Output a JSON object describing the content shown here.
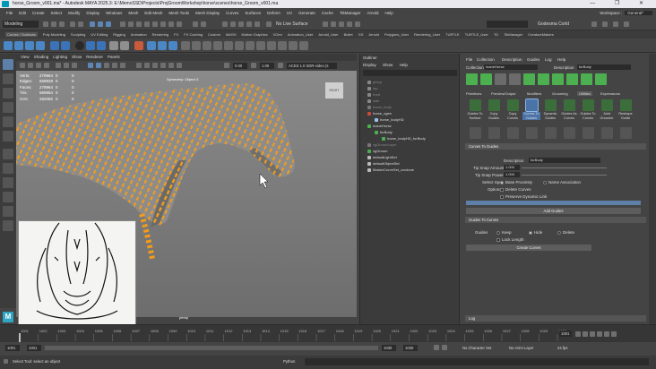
{
  "window": {
    "title": "horse_Groom_v001.ma* - Autodesk MAYA 2025.3: E:\\MemoSSD\\Projects\\ProjGroomWorkshop\\horse\\scenes\\horse_Groom_v001.ma",
    "controls": "— ❐ ✕"
  },
  "menubar": {
    "items": [
      "File",
      "Edit",
      "Create",
      "Select",
      "Modify",
      "Display",
      "Windows",
      "Mesh",
      "Edit Mesh",
      "Mesh Tools",
      "Mesh Display",
      "Curves",
      "Surfaces",
      "Deform",
      "UV",
      "Generate",
      "Cache",
      "TikManager",
      "Arnold",
      "Help"
    ],
    "workspace_label": "Workspace :",
    "workspace_value": "General*"
  },
  "statusline": {
    "mode": "Modeling",
    "live_surface": "No Live Surface",
    "user": "Godesma Corld"
  },
  "shelf": {
    "tabs": [
      "Curves / Surfaces",
      "Poly Modeling",
      "Sculpting",
      "UV Editing",
      "Rigging",
      "Animation",
      "Rendering",
      "FX",
      "FX Caching",
      "Custom",
      "MASH",
      "Motion Graphics",
      "XGen",
      "Animation_User",
      "Arnold_User",
      "Bullet",
      "GS",
      "Arnold",
      "Polygons_User",
      "Rendering_User",
      "TURTLE",
      "TURTLE_User",
      "TD",
      "TikManager",
      "CreatureMakers"
    ],
    "active_tab": 0
  },
  "viewport": {
    "menu": [
      "View",
      "Shading",
      "Lighting",
      "Show",
      "Renderer",
      "Panels"
    ],
    "hud": [
      {
        "label": "Verts:",
        "a": "279964",
        "b": "0",
        "c": "0"
      },
      {
        "label": "Edges:",
        "a": "559928",
        "b": "0",
        "c": "0"
      },
      {
        "label": "Faces:",
        "a": "279964",
        "b": "0",
        "c": "0"
      },
      {
        "label": "Tris:",
        "a": "559964",
        "b": "0",
        "c": "0"
      },
      {
        "label": "UVs:",
        "a": "282082",
        "b": "0",
        "c": "0"
      }
    ],
    "symmetry": "Symmetry: Object X",
    "camera": "persp",
    "viewcube": "RIGHT",
    "exposure": "0.00",
    "gamma": "1.00",
    "colorspace": "ACES 1.0 SDR-video (s"
  },
  "outliner": {
    "title": "Outliner",
    "menu": [
      "Display",
      "Show",
      "Help"
    ],
    "items": [
      {
        "label": "persp",
        "dim": true,
        "indent": 0
      },
      {
        "label": "top",
        "dim": true,
        "indent": 0
      },
      {
        "label": "front",
        "dim": true,
        "indent": 0
      },
      {
        "label": "side",
        "dim": true,
        "indent": 0
      },
      {
        "label": "horse_body",
        "dim": true,
        "indent": 0
      },
      {
        "label": "horse_xgen",
        "dim": false,
        "indent": 0
      },
      {
        "label": "horse_bodyHD",
        "dim": false,
        "indent": 1
      },
      {
        "label": "maneHorse",
        "dim": false,
        "indent": 0
      },
      {
        "label": "furBody",
        "dim": false,
        "indent": 1
      },
      {
        "label": "horse_bodyHD_furBody",
        "dim": false,
        "indent": 2
      },
      {
        "label": "xgGroomLayer",
        "dim": true,
        "indent": 0
      },
      {
        "label": "xgGroom",
        "dim": false,
        "indent": 0
      },
      {
        "label": "defaultLightSet",
        "dim": false,
        "indent": 0
      },
      {
        "label": "defaultObjectSet",
        "dim": false,
        "indent": 0
      },
      {
        "label": "MasterCurveSet_xxxdone",
        "dim": false,
        "indent": 0
      }
    ]
  },
  "xgen": {
    "menu": [
      "File",
      "Collection",
      "Description",
      "Guides",
      "Log",
      "Help"
    ],
    "collection_label": "Collection",
    "collection_value": "maneHorse",
    "description_label": "Description",
    "description_value": "furBody",
    "tabs": [
      "Primitives",
      "Preview/Output",
      "Modifiers",
      "Grooming",
      "Utilities",
      "Expressions"
    ],
    "tools": [
      "Guides To Surface",
      "Copy Guides",
      "Copy Curves",
      "Curves To Guides",
      "Dynamic Guides",
      "Guides As Curves",
      "Guides To Curves",
      "Joint Groomer",
      "Reshape Guide"
    ],
    "curves_to_guides_section": "Curves To Guides",
    "desc_field_label": "Description",
    "desc_field_value": "furBody",
    "tip_snap_label": "Tip Snap Amount",
    "tip_snap_value": "1.000",
    "tip_power_label": "Tip Snap Power",
    "tip_power_value": "1.000",
    "select_spc_label": "Select Spc",
    "opt_base": "Base Proximity",
    "opt_name": "Name Association",
    "options_label": "Options",
    "opt_delete": "Delete Curves",
    "opt_preserve": "Preserve Dynamic Link",
    "add_guides": "Add Guides",
    "guides_to_curves_section": "Guides To Curves",
    "guides_label": "Guides",
    "opt_keep": "Keep",
    "opt_hide": "Hide",
    "opt_del": "Delete",
    "lock_length": "Lock Length",
    "create_curves": "Create Curves",
    "log_label": "Log"
  },
  "timeline": {
    "ticks": [
      "1001",
      "1002",
      "1003",
      "1004",
      "1005",
      "1006",
      "1007",
      "1008",
      "1009",
      "1010",
      "1011",
      "1012",
      "1013",
      "1014",
      "1015",
      "1016",
      "1017",
      "1018",
      "1019",
      "1020",
      "1021",
      "1022",
      "1023",
      "1024",
      "1025",
      "1026",
      "1027",
      "1028",
      "1029",
      "1030"
    ],
    "current": "1001",
    "range_start": "1001",
    "range_inner_start": "1001",
    "range_inner_end": "1030",
    "range_end": "1030",
    "char_set": "No Character Set",
    "anim_layer": "No Anim Layer",
    "fps": "24 fps"
  },
  "commandline": {
    "help": "Select Tool: select an object",
    "lang": "Python"
  },
  "colors": {
    "accent": "#5d7fa8",
    "guides": "#f0a020"
  }
}
